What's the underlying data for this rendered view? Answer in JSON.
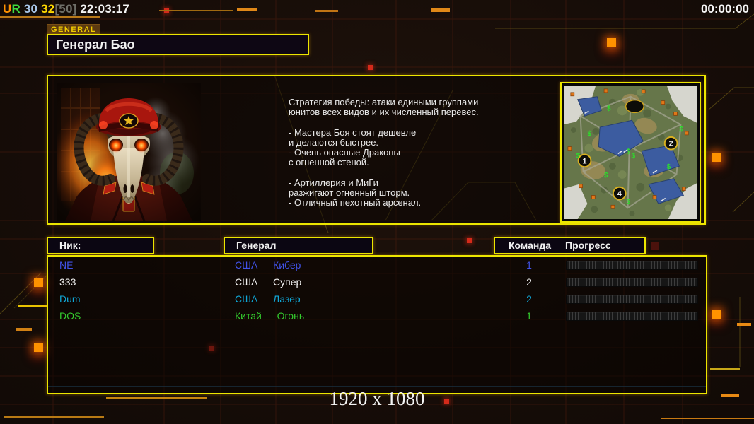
{
  "status_bar": {
    "parts": [
      {
        "text": "U",
        "color": "#ff9100"
      },
      {
        "text": "R",
        "color": "#3fd93f"
      },
      {
        "text": " 30",
        "color": "#a9c6e8"
      },
      {
        "text": " 32",
        "color": "#ffd800"
      },
      {
        "text": "[50]",
        "color": "#6f6f68"
      },
      {
        "text": " 22:03:17",
        "color": "#f5f5f5"
      }
    ],
    "right_timer": "00:00:00"
  },
  "header": {
    "tab_label": "GENERAL",
    "title": "Генерал Бао"
  },
  "main": {
    "strategy_lines": [
      "Стратегия победы: атаки едиными группами",
      "юнитов всех видов и их численный перевес.",
      "",
      "- Мастера Боя стоят дешевле",
      "и делаются быстрее.",
      "- Очень опасные Драконы",
      "с огненной стеной.",
      "",
      "- Артиллерия и МиГи",
      "разжигают огненный шторм.",
      "- Отличный пехотный арсенал."
    ]
  },
  "minimap": {
    "position_labels": [
      "1",
      "2",
      "4"
    ],
    "supply_symbol": "$"
  },
  "table": {
    "headers": {
      "nick": "Ник:",
      "general": "Генерал",
      "team": "Команда",
      "progress": "Прогресс"
    },
    "rows": [
      {
        "nick": "NE",
        "general": "США — Кибер",
        "team": "1",
        "color": "#4152e8"
      },
      {
        "nick": "333",
        "general": "США — Супер",
        "team": "2",
        "color": "#f2f2f2"
      },
      {
        "nick": "Dum",
        "general": "США — Лазер",
        "team": "2",
        "color": "#10a8d8"
      },
      {
        "nick": "DOS",
        "general": "Китай — Огонь",
        "team": "1",
        "color": "#35cc2e"
      }
    ]
  },
  "footer": {
    "resolution": "1920 x 1080"
  },
  "colors": {
    "accent_yellow": "#ece600",
    "accent_orange": "#ff9200"
  }
}
